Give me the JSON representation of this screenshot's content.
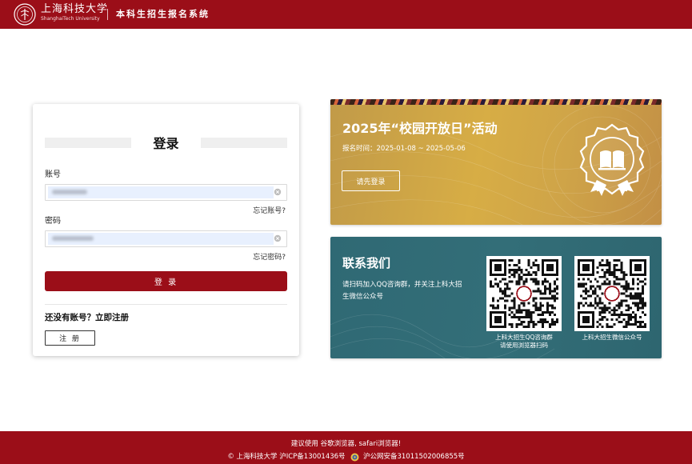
{
  "header": {
    "university_name": "上海科技大学",
    "university_name_en": "ShanghaiTech University",
    "system_name": "本科生招生报名系统",
    "brand_color": "#9b0e18"
  },
  "login": {
    "title": "登录",
    "account_label": "账号",
    "password_label": "密码",
    "forgot_account": "忘记账号?",
    "forgot_password": "忘记密码?",
    "login_button": "登 录",
    "no_account_text": "还没有账号？立即注册",
    "register_button": "注 册",
    "clear_icon": "close-circle-icon"
  },
  "event": {
    "title": "2025年“校园开放日”活动",
    "date_range": "报名时间：2025-01-08 ~ 2025-05-06",
    "button": "请先登录",
    "badge_icon": "open-book-badge-icon",
    "color": "#cfa448"
  },
  "contact": {
    "title": "联系我们",
    "description": "请扫码加入QQ咨询群，并关注上科大招生微信公众号",
    "qq_label_line1": "上科大招生QQ咨询群",
    "qq_label_line2": "请使用浏览器扫码",
    "wechat_label": "上科大招生微信公众号",
    "color": "#2f6974"
  },
  "footer": {
    "browser_tip": "建议使用 谷歌浏览器, safari浏览器!",
    "copyright": "© 上海科技大学  沪ICP备13001436号",
    "police_record": "沪公网安备31011502006855号"
  }
}
